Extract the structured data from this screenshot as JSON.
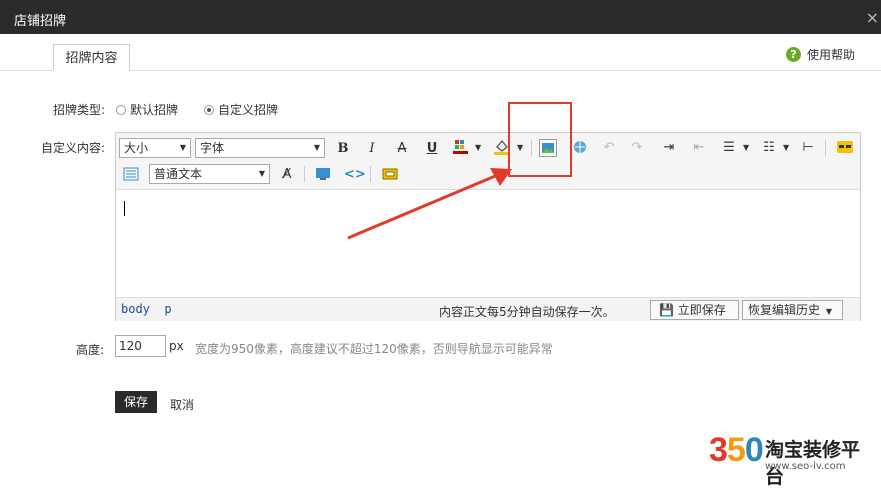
{
  "window": {
    "title": "店铺招牌",
    "close_icon": "×"
  },
  "tabs": [
    {
      "label": "招牌内容",
      "active": true
    }
  ],
  "help": {
    "icon": "?",
    "label": "使用帮助"
  },
  "form": {
    "type_label": "招牌类型:",
    "type_options": [
      {
        "label": "默认招牌",
        "selected": false
      },
      {
        "label": "自定义招牌",
        "selected": true
      }
    ],
    "content_label": "自定义内容:",
    "height_label": "高度:",
    "height_value": "120",
    "height_unit": "px",
    "height_hint": "宽度为950像素，高度建议不超过120像素，否则导航显示可能异常",
    "save_label": "保存",
    "cancel_label": "取消"
  },
  "editor": {
    "size_select": "大小",
    "font_select": "字体",
    "paragraph_select": "普通文本",
    "bold_glyph": "B",
    "italic_glyph": "I",
    "strike_glyph": "A",
    "underline_glyph": "U",
    "path_body": "body",
    "path_p": "p",
    "autosave_note": "内容正文每5分钟自动保存一次。",
    "save_now_label": "立即保存",
    "restore_label": "恢复编辑历史"
  },
  "colors": {
    "highlight": "#e23a2a",
    "text_color_bar": "#c00000",
    "bg_color_bar": "#f5c400",
    "title_bar": "#2b2b2b"
  },
  "watermark": {
    "number": "350",
    "site_name": "淘宝装修平台",
    "url": "www.seo-lv.com"
  }
}
